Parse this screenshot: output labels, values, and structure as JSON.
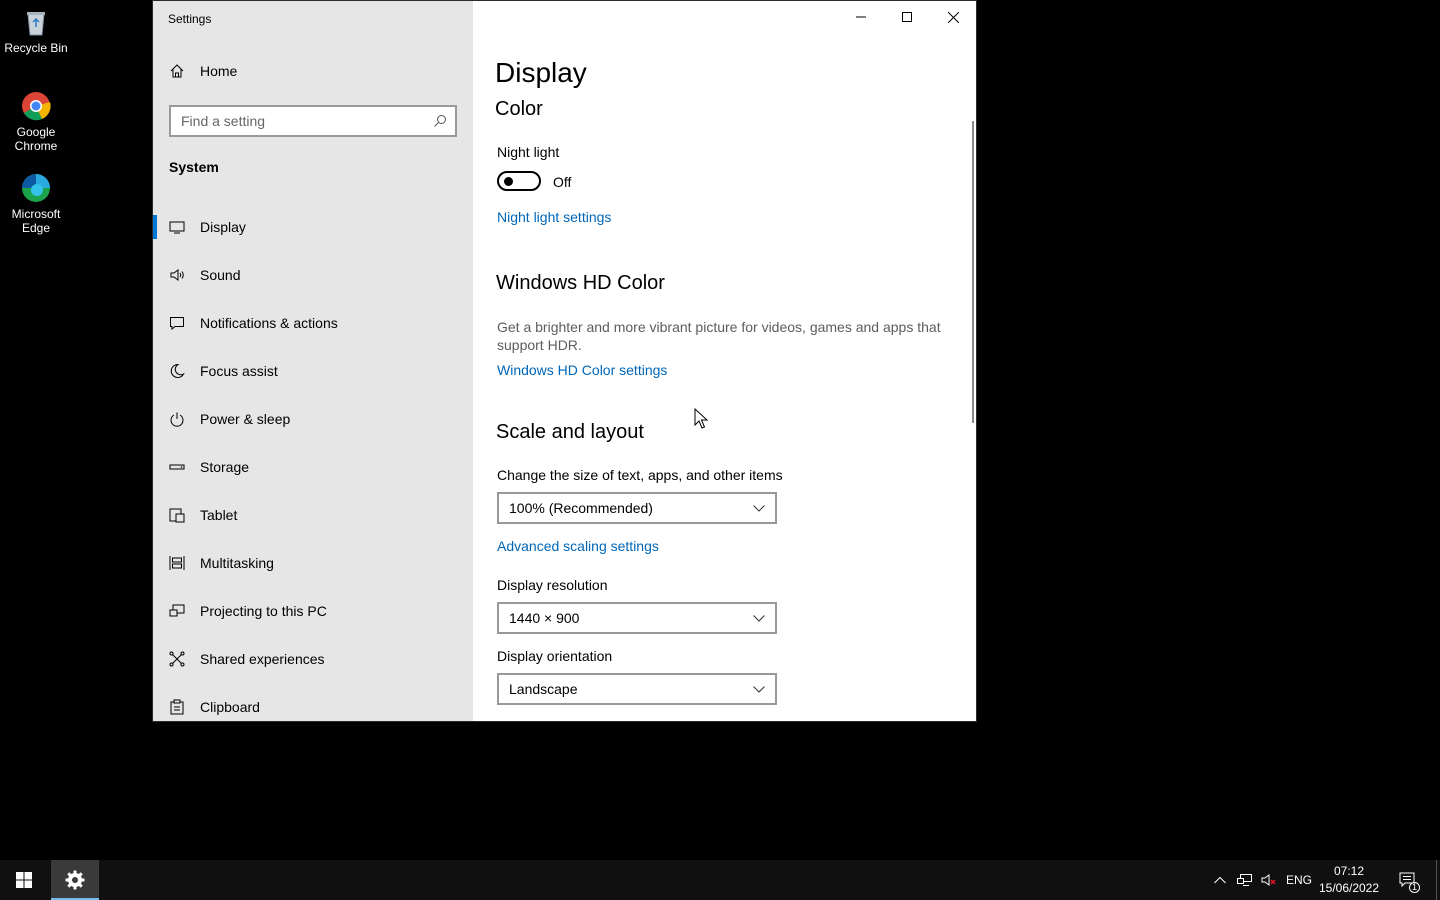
{
  "desktop": {
    "icons": [
      {
        "label": "Recycle Bin",
        "icon": "recycle-bin-icon"
      },
      {
        "label": "Google Chrome",
        "icon": "chrome-icon"
      },
      {
        "label": "Microsoft Edge",
        "icon": "edge-icon"
      }
    ]
  },
  "window": {
    "title": "Settings",
    "controls": [
      "minimize-icon",
      "maximize-icon",
      "close-icon"
    ]
  },
  "sidebar": {
    "home_label": "Home",
    "search_placeholder": "Find a setting",
    "section": "System",
    "items": [
      {
        "label": "Display",
        "icon": "monitor-icon",
        "active": true
      },
      {
        "label": "Sound",
        "icon": "speaker-icon"
      },
      {
        "label": "Notifications & actions",
        "icon": "message-icon"
      },
      {
        "label": "Focus assist",
        "icon": "moon-icon"
      },
      {
        "label": "Power & sleep",
        "icon": "power-icon"
      },
      {
        "label": "Storage",
        "icon": "storage-icon"
      },
      {
        "label": "Tablet",
        "icon": "tablet-icon"
      },
      {
        "label": "Multitasking",
        "icon": "multitasking-icon"
      },
      {
        "label": "Projecting to this PC",
        "icon": "projecting-icon"
      },
      {
        "label": "Shared experiences",
        "icon": "shared-icon"
      },
      {
        "label": "Clipboard",
        "icon": "clipboard-icon"
      }
    ]
  },
  "main": {
    "page_title": "Display",
    "color": {
      "heading": "Color",
      "night_light_label": "Night light",
      "night_light_state": "Off",
      "night_light_link": "Night light settings"
    },
    "hd_color": {
      "heading": "Windows HD Color",
      "description": "Get a brighter and more vibrant picture for videos, games and apps that support HDR.",
      "link": "Windows HD Color settings"
    },
    "scale": {
      "heading": "Scale and layout",
      "size_label": "Change the size of text, apps, and other items",
      "size_value": "100% (Recommended)",
      "advanced_link": "Advanced scaling settings",
      "resolution_label": "Display resolution",
      "resolution_value": "1440 × 900",
      "orientation_label": "Display orientation",
      "orientation_value": "Landscape"
    }
  },
  "taskbar": {
    "language": "ENG",
    "time": "07:12",
    "date": "15/06/2022",
    "notification_count": "1"
  },
  "colors": {
    "accent": "#0078d4",
    "link": "#0067b8",
    "sidebar_bg": "#e6e6e6"
  }
}
